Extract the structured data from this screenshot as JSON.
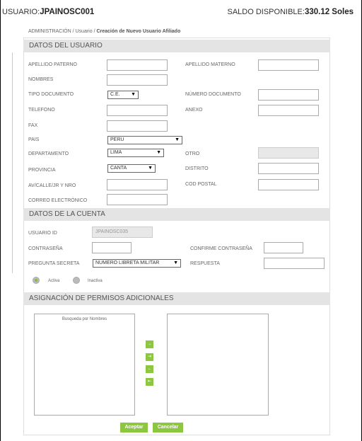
{
  "header": {
    "user_label": "USUARIO:",
    "user_value": "JPAINOSC001",
    "balance_label": "SALDO DISPONIBLE:",
    "balance_value": "330.12 Soles"
  },
  "breadcrumb": {
    "path": "ADMINISTRACIÓN / Usuario / ",
    "current": "Creación de Nuevo Usuario Afiliado"
  },
  "user_section": {
    "title": "DATOS DEL USUARIO",
    "apellido_paterno": "APELLIDO PATERNO",
    "apellido_materno": "APELLIDO MATERNO",
    "nombres": "NOMBRES",
    "tipo_documento": "TIPO DOCUMENTO",
    "tipo_documento_value": "C.E.",
    "numero_documento": "NÚMERO DOCUMENTO",
    "telefono": "TELEFONO",
    "anexo": "ANEXO",
    "fax": "FAX",
    "pais": "PAIS",
    "pais_value": "PERU",
    "departamento": "DEPARTAMENTO",
    "departamento_value": "LIMA",
    "otro": "OTRO",
    "provincia": "PROVINCIA",
    "provincia_value": "CANTA",
    "distrito": "DISTRITO",
    "direccion": "AV/CALLE/JR Y NRO",
    "cod_postal": "COD POSTAL",
    "correo": "CORREO ELECTRÓNICO"
  },
  "account_section": {
    "title": "DATOS DE LA CUENTA",
    "usuario_id": "USUARIO ID",
    "usuario_id_value": "JPAINOSC035",
    "contrasena": "CONTRASEÑA",
    "confirme": "CONFIRME CONTRASEÑA",
    "pregunta": "PREGUNTA SECRETA",
    "pregunta_value": "NUMERO LIBRETA MILITAR",
    "respuesta": "RESPUESTA",
    "activa": "Activa",
    "inactiva": "Inactiva"
  },
  "permissions_section": {
    "title": "ASIGNACIÓN DE PERMISOS ADICIONALES",
    "search_label": "Busqueda por Nombres",
    "move_buttons": [
      "→",
      "⇥",
      "←",
      "⇤"
    ]
  },
  "actions": {
    "accept": "Aceptar",
    "cancel": "Cancelar"
  }
}
